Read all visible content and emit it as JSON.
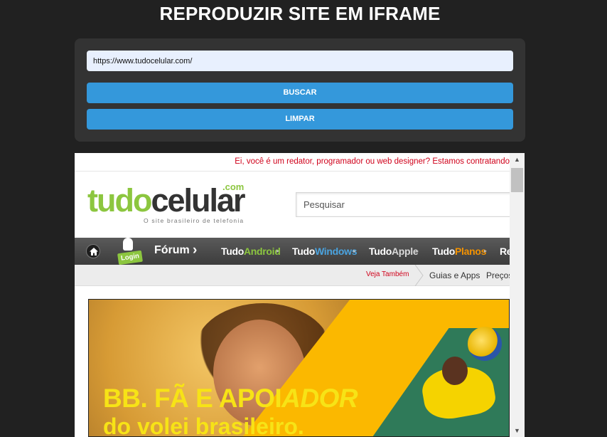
{
  "page": {
    "title": "REPRODUZIR SITE EM IFRAME"
  },
  "form": {
    "url_value": "https://www.tudocelular.com/",
    "search_button": "BUSCAR",
    "clear_button": "LIMPAR"
  },
  "colors": {
    "background": "#212121",
    "panel": "#333333",
    "button": "#3498db",
    "input": "#e8f0fe"
  },
  "site": {
    "recruit_text": "Ei, você é um redator, programador ou web designer? Estamos contratando",
    "logo": {
      "tudo": "tudo",
      "celular": "celular",
      "com": ".com",
      "tagline": "O site brasileiro de telefonia"
    },
    "search_placeholder": "Pesquisar",
    "nav": {
      "login": "Login",
      "forum": "Fórum",
      "items": [
        {
          "prefix": "Tudo",
          "suffix": "Android"
        },
        {
          "prefix": "Tudo",
          "suffix": "Windows"
        },
        {
          "prefix": "Tudo",
          "suffix": "Apple"
        },
        {
          "prefix": "Tudo",
          "suffix": "Planos"
        },
        {
          "prefix": "Re",
          "suffix": ""
        }
      ]
    },
    "subnav": {
      "veja": "Veja Também",
      "guias": "Guias e Apps",
      "precos": "Preços"
    },
    "banner": {
      "line1_a": "BB.",
      "line1_b": "FÃ E APOI",
      "line1_c": "ADOR",
      "line2": "do volei brasileiro."
    }
  }
}
